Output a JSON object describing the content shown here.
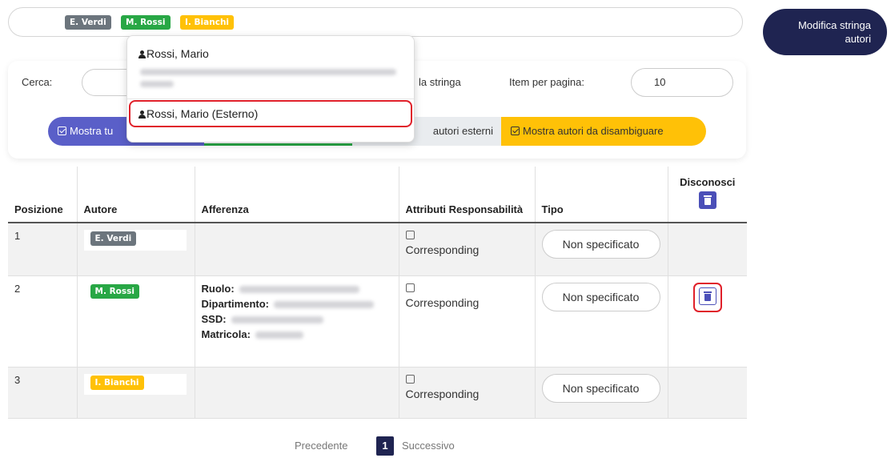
{
  "author_bar": {
    "tags": [
      {
        "label": "E. Verdi",
        "color": "#6c757d"
      },
      {
        "label": "M. Rossi",
        "color": "#28a745"
      },
      {
        "label": "I. Bianchi",
        "color": "#ffc107"
      }
    ]
  },
  "modify_button": {
    "label": "Modifica stringa\nautori"
  },
  "filters": {
    "search_label": "Cerca:",
    "string_label": "la stringa",
    "per_page_label": "Item per pagina:",
    "per_page_value": "10",
    "toggles": [
      {
        "label": "Mostra tu",
        "checked": true
      },
      {
        "label": "",
        "checked": false
      },
      {
        "label": "autori esterni",
        "checked": false
      },
      {
        "label": "Mostra autori da disambiguare",
        "checked": true
      }
    ]
  },
  "dropdown": {
    "items": [
      {
        "label": "Rossi, Mario",
        "icon": "user-icon"
      },
      {
        "label": "Rossi, Mario (Esterno)",
        "icon": "user-icon"
      }
    ]
  },
  "table": {
    "headers": {
      "position": "Posizione",
      "author": "Autore",
      "affiliation": "Afferenza",
      "attributes": "Attributi Responsabilità",
      "type": "Tipo",
      "disown": "Disconosci"
    },
    "rows": [
      {
        "position": "1",
        "author": "E. Verdi",
        "attribute": "Corresponding",
        "type": "Non specificato"
      },
      {
        "position": "2",
        "author": "M. Rossi",
        "attribute": "Corresponding",
        "type": "Non specificato",
        "affiliation": {
          "role": "Ruolo:",
          "department": "Dipartimento:",
          "ssd": "SSD:",
          "id": "Matricola:"
        }
      },
      {
        "position": "3",
        "author": "I. Bianchi",
        "attribute": "Corresponding",
        "type": "Non specificato"
      }
    ]
  },
  "pager": {
    "prev": "Precedente",
    "current": "1",
    "next": "Successivo"
  }
}
